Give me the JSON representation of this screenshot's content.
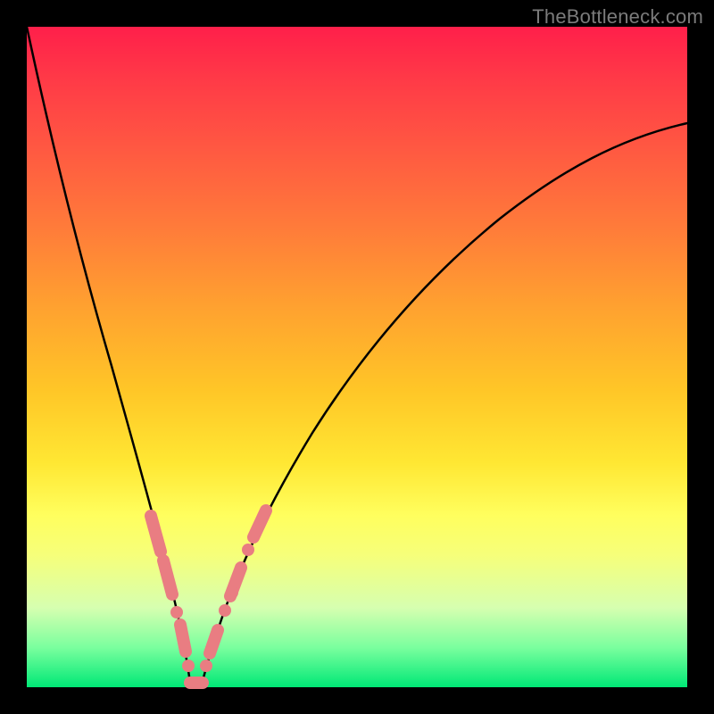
{
  "watermark": "TheBottleneck.com",
  "colors": {
    "frame": "#000000",
    "watermark": "#7b7b7b",
    "curve": "#000000",
    "marker": "#e97d82",
    "gradient_stops": [
      "#ff1f4a",
      "#ff3a47",
      "#ff5742",
      "#ff7a3a",
      "#ffa030",
      "#ffc627",
      "#ffe733",
      "#ffff5e",
      "#f6ff7a",
      "#d6ffb0",
      "#7aff9e",
      "#00e876"
    ]
  },
  "chart_data": {
    "type": "line",
    "title": "",
    "xlabel": "",
    "ylabel": "",
    "xlim": [
      0,
      100
    ],
    "ylim": [
      0,
      100
    ],
    "note": "Background is a vertical heat gradient (red=high risk at top, green=optimal at bottom). Curve shows bottleneck percentage vs. component balance; minimum near x≈25 where bottleneck≈0.",
    "series": [
      {
        "name": "bottleneck_curve",
        "x": [
          0,
          2,
          4,
          6,
          8,
          10,
          12,
          14,
          16,
          18,
          20,
          22,
          23,
          24,
          25,
          26,
          27,
          28,
          30,
          32,
          35,
          40,
          45,
          50,
          55,
          60,
          65,
          70,
          75,
          80,
          85,
          90,
          95,
          100
        ],
        "y": [
          100,
          90,
          81,
          72,
          64,
          56,
          48,
          41,
          34,
          27,
          20,
          12,
          8,
          3,
          0,
          0,
          3,
          8,
          15,
          22,
          30,
          41,
          49,
          56,
          62,
          67,
          71,
          74,
          77,
          79,
          81,
          83,
          84,
          85
        ]
      }
    ],
    "markers": {
      "comment": "Highlighted sample points/segments on the curve near the valley",
      "points_x": [
        18,
        19.5,
        21,
        22.5,
        23.5,
        24.5,
        25.5,
        26.5,
        28,
        29.5,
        31,
        33,
        34.5
      ],
      "points_y": [
        27,
        22,
        16,
        10,
        6,
        1,
        0,
        3,
        8,
        13,
        19,
        25,
        29
      ]
    }
  }
}
